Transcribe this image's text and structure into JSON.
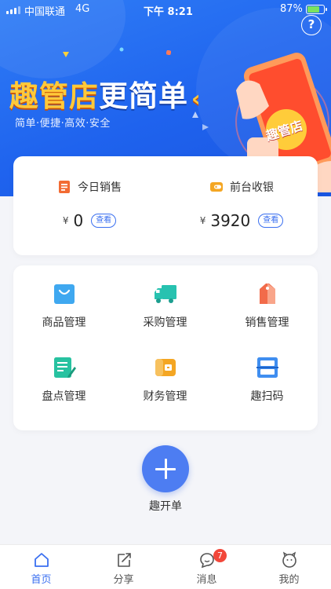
{
  "status_bar": {
    "carrier": "中国联通",
    "network": "4G",
    "time": "下午 8:21",
    "battery": "87%"
  },
  "header": {
    "help_label": "?"
  },
  "banner": {
    "title_highlight": "趣管店",
    "title_rest": "更简单",
    "subtitle": "简单·便捷·高效·安全",
    "phone_text": "趣管店"
  },
  "stats": [
    {
      "label": "今日销售",
      "currency": "¥",
      "value": "0",
      "action": "查看",
      "icon": "sales-doc-icon",
      "color": "#f26b33"
    },
    {
      "label": "前台收银",
      "currency": "¥",
      "value": "3920",
      "action": "查看",
      "icon": "wallet-icon",
      "color": "#f4a623"
    }
  ],
  "menu": [
    {
      "label": "商品管理",
      "icon": "shopping-bag-icon",
      "color": "#3fa8f0"
    },
    {
      "label": "采购管理",
      "icon": "truck-icon",
      "color": "#27c2b0"
    },
    {
      "label": "销售管理",
      "icon": "tag-icon",
      "color": "#f26b4a"
    },
    {
      "label": "盘点管理",
      "icon": "inventory-edit-icon",
      "color": "#27c2a0"
    },
    {
      "label": "财务管理",
      "icon": "finance-wallet-icon",
      "color": "#f4a623"
    },
    {
      "label": "趣扫码",
      "icon": "scan-icon",
      "color": "#3f8ef0"
    }
  ],
  "fab": {
    "label": "趣开单",
    "icon": "plus-icon"
  },
  "tabs": [
    {
      "label": "首页",
      "icon": "home-icon",
      "active": true
    },
    {
      "label": "分享",
      "icon": "share-icon",
      "active": false
    },
    {
      "label": "消息",
      "icon": "message-icon",
      "active": false,
      "badge": "7"
    },
    {
      "label": "我的",
      "icon": "profile-face-icon",
      "active": false
    }
  ],
  "colors": {
    "primary": "#3a6ff0",
    "banner": "#1f63ee",
    "badge": "#f2473a",
    "page_bg": "#f4f5f9"
  }
}
